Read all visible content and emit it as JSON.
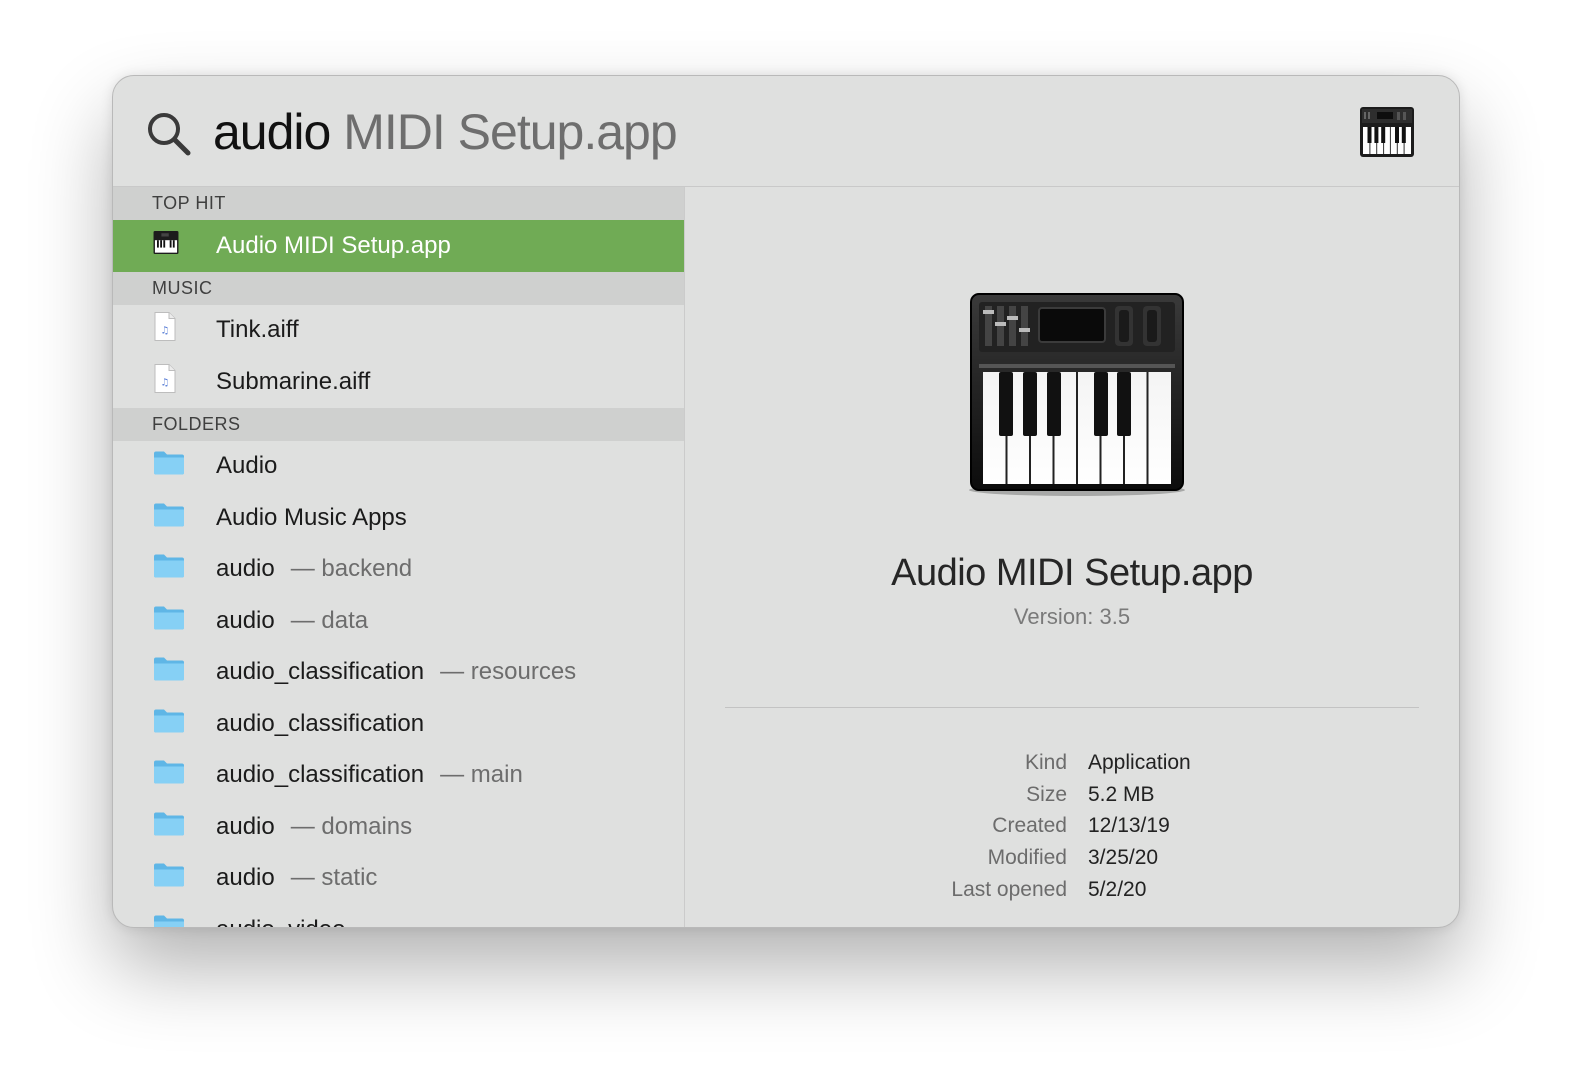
{
  "search": {
    "typed": "audio",
    "completion": " MIDI Setup.app"
  },
  "results": {
    "sections": [
      {
        "title": "TOP HIT",
        "items": [
          {
            "icon": "piano-app-icon",
            "label": "Audio MIDI Setup.app",
            "sub": "",
            "selected": true
          }
        ]
      },
      {
        "title": "MUSIC",
        "items": [
          {
            "icon": "audio-file-icon",
            "label": "Tink.aiff",
            "sub": ""
          },
          {
            "icon": "audio-file-icon",
            "label": "Submarine.aiff",
            "sub": ""
          }
        ]
      },
      {
        "title": "FOLDERS",
        "items": [
          {
            "icon": "folder-icon",
            "label": "Audio",
            "sub": ""
          },
          {
            "icon": "folder-icon",
            "label": "Audio Music Apps",
            "sub": ""
          },
          {
            "icon": "folder-icon",
            "label": "audio",
            "sub": "— backend"
          },
          {
            "icon": "folder-icon",
            "label": "audio",
            "sub": "— data"
          },
          {
            "icon": "folder-icon",
            "label": "audio_classification",
            "sub": "— resources"
          },
          {
            "icon": "folder-icon",
            "label": "audio_classification",
            "sub": ""
          },
          {
            "icon": "folder-icon",
            "label": "audio_classification",
            "sub": "— main"
          },
          {
            "icon": "folder-icon",
            "label": "audio",
            "sub": "— domains"
          },
          {
            "icon": "folder-icon",
            "label": "audio",
            "sub": "— static"
          },
          {
            "icon": "folder-icon",
            "label": "audio_video",
            "sub": ""
          }
        ]
      }
    ]
  },
  "preview": {
    "title": "Audio MIDI Setup.app",
    "version": "Version: 3.5",
    "meta": [
      {
        "key": "Kind",
        "value": "Application"
      },
      {
        "key": "Size",
        "value": "5.2 MB"
      },
      {
        "key": "Created",
        "value": "12/13/19"
      },
      {
        "key": "Modified",
        "value": "3/25/20"
      },
      {
        "key": "Last opened",
        "value": "5/2/20"
      }
    ]
  },
  "colors": {
    "selection": "#70ab55",
    "folder": "#6fc3ee",
    "window_bg": "#dfe0df",
    "section_bg": "#cfd0cf"
  }
}
